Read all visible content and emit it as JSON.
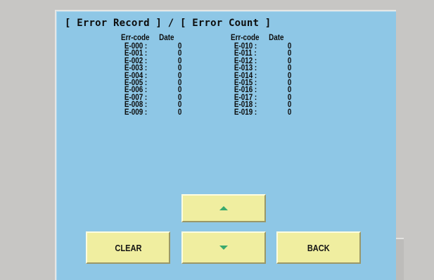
{
  "header": {
    "title": "[ Error Record ] / [ Error Count ]"
  },
  "table": {
    "col_code_header": "Err-code",
    "col_date_header": "Date",
    "left_rows": [
      {
        "code": "E-000 :",
        "value": "0"
      },
      {
        "code": "E-001 :",
        "value": "0"
      },
      {
        "code": "E-002 :",
        "value": "0"
      },
      {
        "code": "E-003 :",
        "value": "0"
      },
      {
        "code": "E-004 :",
        "value": "0"
      },
      {
        "code": "E-005 :",
        "value": "0"
      },
      {
        "code": "E-006 :",
        "value": "0"
      },
      {
        "code": "E-007 :",
        "value": "0"
      },
      {
        "code": "E-008 :",
        "value": "0"
      },
      {
        "code": "E-009 :",
        "value": "0"
      }
    ],
    "right_rows": [
      {
        "code": "E-010 :",
        "value": "0"
      },
      {
        "code": "E-011 :",
        "value": "0"
      },
      {
        "code": "E-012 :",
        "value": "0"
      },
      {
        "code": "E-013 :",
        "value": "0"
      },
      {
        "code": "E-014 :",
        "value": "0"
      },
      {
        "code": "E-015 :",
        "value": "0"
      },
      {
        "code": "E-016 :",
        "value": "0"
      },
      {
        "code": "E-017 :",
        "value": "0"
      },
      {
        "code": "E-018 :",
        "value": "0"
      },
      {
        "code": "E-019 :",
        "value": "0"
      }
    ]
  },
  "buttons": {
    "clear_label": "CLEAR",
    "back_label": "BACK",
    "up_icon": "arrow-up-icon",
    "down_icon": "arrow-down-icon"
  },
  "colors": {
    "screen_bg": "#8ec7e6",
    "button_bg": "#f0eea0",
    "arrow": "#3aa96d",
    "bezel": "#c7c6c4"
  }
}
